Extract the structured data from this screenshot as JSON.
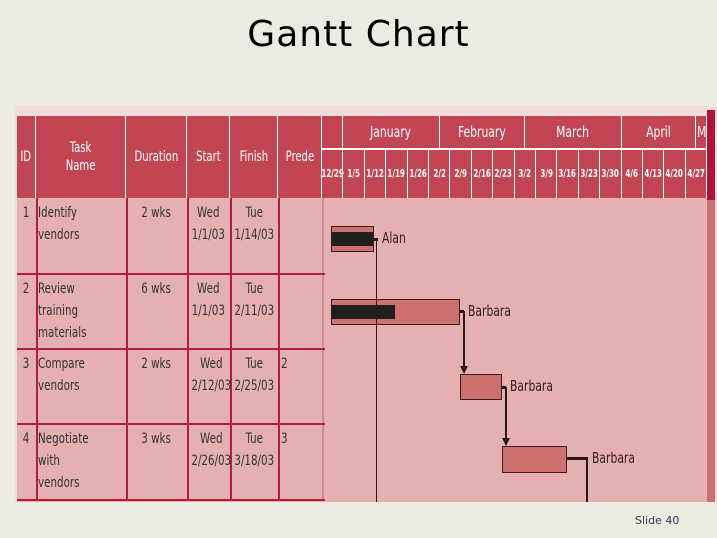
{
  "slide": {
    "title": "Gantt Chart",
    "slide_number": "Slide 40"
  },
  "table": {
    "headers": [
      "ID",
      "Task\nName",
      "Duration",
      "Start",
      "Finish",
      "Prede"
    ],
    "rows": [
      {
        "id": "1",
        "task": "Identify\nvendors",
        "duration": "2 wks",
        "start": "Wed\n1/1/03",
        "finish": "Tue\n1/14/03",
        "pred": "",
        "resource": "Alan",
        "progress": 1.0
      },
      {
        "id": "2",
        "task": "Review\ntraining\nmaterials",
        "duration": "6 wks",
        "start": "Wed\n1/1/03",
        "finish": "Tue\n2/11/03",
        "pred": "",
        "resource": "Barbara",
        "progress": 0.5
      },
      {
        "id": "3",
        "task": "Compare\nvendors",
        "duration": "2 wks",
        "start": "Wed\n2/12/03",
        "finish": "Tue\n2/25/03",
        "pred": "2",
        "resource": "Barbara",
        "progress": 0
      },
      {
        "id": "4",
        "task": "Negotiate\nwith\nvendors",
        "duration": "3 wks",
        "start": "Wed\n2/26/03",
        "finish": "Tue\n3/18/03",
        "pred": "3",
        "resource": "Barbara",
        "progress": 0
      }
    ]
  },
  "timeline": {
    "months": [
      {
        "label": "",
        "weeks": 1
      },
      {
        "label": "January",
        "weeks": 4.5
      },
      {
        "label": "February",
        "weeks": 4
      },
      {
        "label": "March",
        "weeks": 4.5
      },
      {
        "label": "April",
        "weeks": 3.5
      },
      {
        "label": "M",
        "weeks": 0.5
      }
    ],
    "weeks": [
      "12/29",
      "1/5",
      "1/12",
      "1/19",
      "1/26",
      "2/2",
      "2/9",
      "2/16",
      "2/23",
      "3/2",
      "3/9",
      "3/16",
      "3/23",
      "3/30",
      "4/6",
      "4/13",
      "4/20",
      "4/27"
    ]
  },
  "chart_data": {
    "type": "gantt",
    "title": "Gantt Chart",
    "tasks": [
      {
        "id": 1,
        "name": "Identify vendors",
        "start": "2003-01-01",
        "finish": "2003-01-14",
        "duration_weeks": 2,
        "resource": "Alan",
        "predecessor": null,
        "percent_complete": 100
      },
      {
        "id": 2,
        "name": "Review training materials",
        "start": "2003-01-01",
        "finish": "2003-02-11",
        "duration_weeks": 6,
        "resource": "Barbara",
        "predecessor": null,
        "percent_complete": 50
      },
      {
        "id": 3,
        "name": "Compare vendors",
        "start": "2003-02-12",
        "finish": "2003-02-25",
        "duration_weeks": 2,
        "resource": "Barbara",
        "predecessor": 2,
        "percent_complete": 0
      },
      {
        "id": 4,
        "name": "Negotiate with vendors",
        "start": "2003-02-26",
        "finish": "2003-03-18",
        "duration_weeks": 3,
        "resource": "Barbara",
        "predecessor": 3,
        "percent_complete": 0
      }
    ],
    "x_ticks": [
      "12/29",
      "1/5",
      "1/12",
      "1/19",
      "1/26",
      "2/2",
      "2/9",
      "2/16",
      "2/23",
      "3/2",
      "3/9",
      "3/16",
      "3/23",
      "3/30",
      "4/6",
      "4/13",
      "4/20",
      "4/27"
    ],
    "x_range": [
      "2002-12-29",
      "2003-05-03"
    ]
  },
  "colors": {
    "header": "#c24553",
    "body": "#e4b0b0",
    "bar": "#cd7070",
    "progress": "#1f1f1f",
    "grid": "#b11f3c"
  }
}
